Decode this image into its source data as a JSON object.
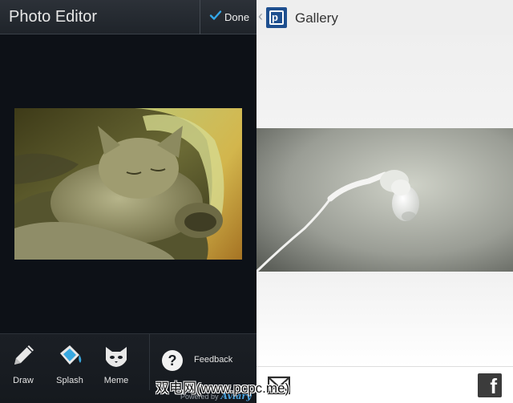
{
  "editor": {
    "title": "Photo Editor",
    "done_label": "Done",
    "tools": [
      {
        "label": "Draw",
        "icon": "pencil-icon"
      },
      {
        "label": "Splash",
        "icon": "paint-bucket-icon"
      },
      {
        "label": "Meme",
        "icon": "cat-mask-icon"
      }
    ],
    "feedback_label": "Feedback",
    "powered_by": "Powered by",
    "brand": "Aviary"
  },
  "gallery": {
    "title": "Gallery",
    "share_icons": [
      "mail-icon",
      "facebook-icon"
    ]
  },
  "watermark": "双电网(www.pcpc.me)",
  "colors": {
    "editor_bg": "#0d1117",
    "editor_bar": "#262b31",
    "gallery_bg": "#f2f2f2",
    "logo_blue": "#1e4f8f",
    "aviary_blue": "#4aa3df"
  }
}
